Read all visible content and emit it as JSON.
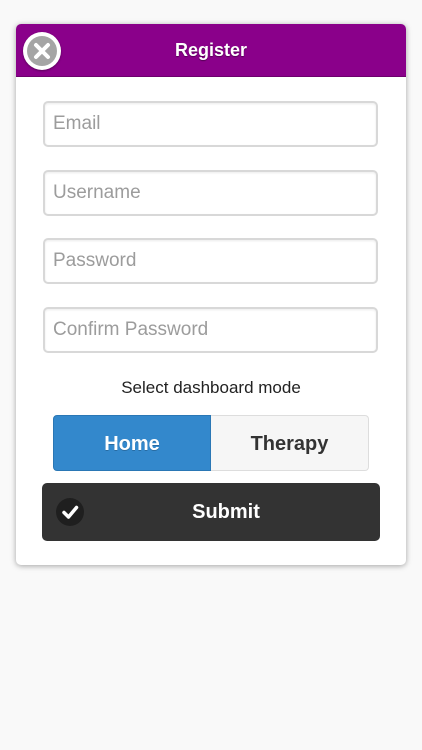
{
  "dialog": {
    "title": "Register",
    "close_icon": "close-icon"
  },
  "form": {
    "email_placeholder": "Email",
    "username_placeholder": "Username",
    "password_placeholder": "Password",
    "confirm_password_placeholder": "Confirm Password"
  },
  "dashboard_mode": {
    "label": "Select dashboard mode",
    "options": [
      "Home",
      "Therapy"
    ],
    "selected": "Home"
  },
  "submit": {
    "label": "Submit",
    "icon": "checkmark-icon"
  },
  "colors": {
    "header": "#8a008a",
    "selected_segment": "#3388cc",
    "submit_button": "#333333"
  }
}
